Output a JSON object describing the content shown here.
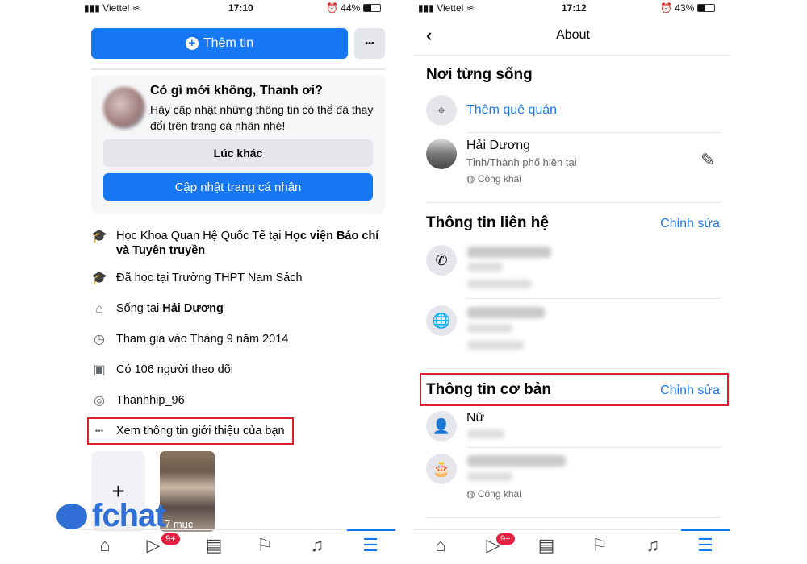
{
  "left": {
    "status": {
      "carrier": "Viettel",
      "time": "17:10",
      "battery": "44%"
    },
    "add_story": "Thêm tin",
    "more": "•••",
    "prompt": {
      "title": "Có gì mới không, Thanh ơi?",
      "text": "Hãy cập nhật những thông tin có thể đã thay đổi trên trang cá nhân nhé!",
      "later": "Lúc khác",
      "update": "Cập nhật trang cá nhân"
    },
    "items": [
      {
        "icon": "graduation-cap-icon",
        "pre": "Học Khoa Quan Hệ Quốc Tế tại ",
        "bold": "Học viện Báo chí và Tuyên truyền"
      },
      {
        "icon": "graduation-cap-icon",
        "pre": "Đã học tại Trường THPT Nam Sách",
        "bold": ""
      },
      {
        "icon": "home-icon",
        "pre": "Sống tại ",
        "bold": "Hải Dương"
      },
      {
        "icon": "clock-icon",
        "pre": "Tham gia vào Tháng 9 năm 2014",
        "bold": ""
      },
      {
        "icon": "followers-icon",
        "pre": "Có 106 người theo dõi",
        "bold": ""
      },
      {
        "icon": "instagram-icon",
        "pre": "Thanhhip_96",
        "bold": ""
      },
      {
        "icon": "more-icon",
        "pre": "Xem thông tin giới thiệu của bạn",
        "bold": ""
      }
    ],
    "featured_label": "7 mục",
    "badge": "9+"
  },
  "right": {
    "status": {
      "carrier": "Viettel",
      "time": "17:12",
      "battery": "43%"
    },
    "title": "About",
    "places": {
      "header": "Nơi từng sống",
      "add_hometown": "Thêm quê quán",
      "city": "Hải Dương",
      "city_sub": "Tỉnh/Thành phố hiện tại",
      "privacy": "Công khai"
    },
    "contact": {
      "header": "Thông tin liên hệ",
      "edit": "Chỉnh sửa"
    },
    "basic": {
      "header": "Thông tin cơ bản",
      "edit": "Chỉnh sửa",
      "gender": "Nữ",
      "privacy": "Công khai"
    },
    "badge": "9+"
  },
  "logo": "fchat",
  "colors": {
    "accent": "#1877f2",
    "highlight": "#d9202c",
    "badge": "#e41e3f"
  }
}
